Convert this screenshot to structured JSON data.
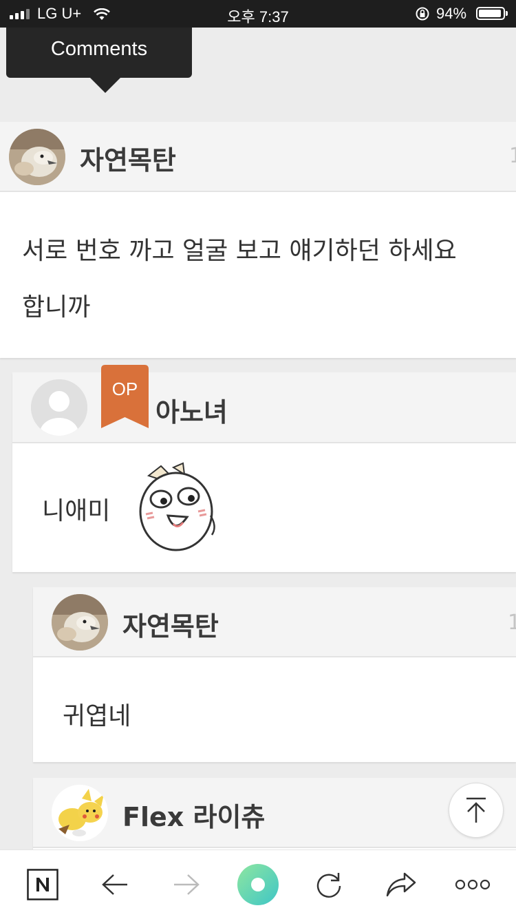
{
  "status_bar": {
    "carrier": "LG U+",
    "time": "오후 7:37",
    "battery": "94%",
    "battery_level": 0.94
  },
  "tooltip": {
    "label": "Comments"
  },
  "comments": [
    {
      "author": "자연목탄",
      "body_lines": [
        "서로 번호 까고 얼굴 보고 얘기하던 하세요",
        "합니까"
      ],
      "edge_digit": "1"
    },
    {
      "author": "아노녀",
      "badge": "OP",
      "body": "니애미"
    },
    {
      "author": "자연목탄",
      "body": "귀엽네",
      "edge_digit": "1"
    },
    {
      "author": "Flex 라이츄"
    }
  ],
  "colors": {
    "op_badge": "#d9713a",
    "status_bar_bg": "#1e1e1e",
    "page_bg": "#ececec",
    "header_bg": "#f4f4f4",
    "refresh_ring_from": "#8ee6a0",
    "refresh_ring_to": "#3fc6c6"
  },
  "toolbar_icons": [
    "naver-n-icon",
    "back-arrow-icon",
    "forward-arrow-icon",
    "green-dot-icon",
    "refresh-icon",
    "share-icon",
    "more-icon"
  ]
}
